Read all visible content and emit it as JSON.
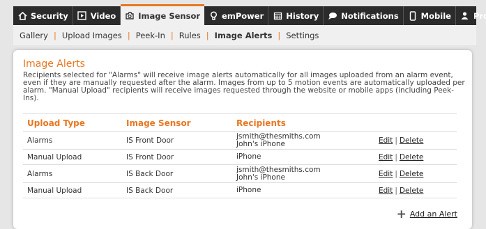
{
  "top_tabs": [
    {
      "label": "Security",
      "icon": "home-icon"
    },
    {
      "label": "Video",
      "icon": "play-icon"
    },
    {
      "label": "Image Sensor",
      "icon": "camera-icon"
    },
    {
      "label": "emPower",
      "icon": "bulb-icon"
    },
    {
      "label": "History",
      "icon": "calendar-icon"
    },
    {
      "label": "Notifications",
      "icon": "chat-bubble-icon"
    },
    {
      "label": "Mobile",
      "icon": "phone-icon"
    },
    {
      "label": "Profile",
      "icon": "person-icon"
    }
  ],
  "sub_nav": [
    "Gallery",
    "Upload Images",
    "Peek-In",
    "Rules",
    "Image Alerts",
    "Settings"
  ],
  "panel": {
    "title": "Image Alerts",
    "description": "Recipients selected for \"Alarms\" will receive image alerts automatically for all images uploaded from an alarm event, even if they are manually requested after the alarm. Images from up to 5 motion events are automatically uploaded per alarm. \"Manual Upload\" recipients will receive images requested through the website or mobile apps (including Peek-Ins)."
  },
  "table": {
    "headers": [
      "Upload Type",
      "Image Sensor",
      "Recipients"
    ],
    "rows": [
      {
        "type": "Alarms",
        "sensor": "IS Front Door",
        "recipient1": "jsmith@thesmiths.com",
        "recipient2": "John's iPhone"
      },
      {
        "type": "Manual Upload",
        "sensor": "IS Front Door",
        "recipient1": "iPhone",
        "recipient2": ""
      },
      {
        "type": "Alarms",
        "sensor": "IS Back Door",
        "recipient1": "jsmith@thesmiths.com",
        "recipient2": "John's iPhone"
      },
      {
        "type": "Manual Upload",
        "sensor": "IS Back Door",
        "recipient1": "iPhone",
        "recipient2": ""
      }
    ],
    "edit_label": "Edit",
    "delete_label": "Delete",
    "separator": "|"
  },
  "add_alert_label": "Add an Alert",
  "colors": {
    "accent": "#e87722",
    "nav_bg": "#2b2b2b"
  }
}
